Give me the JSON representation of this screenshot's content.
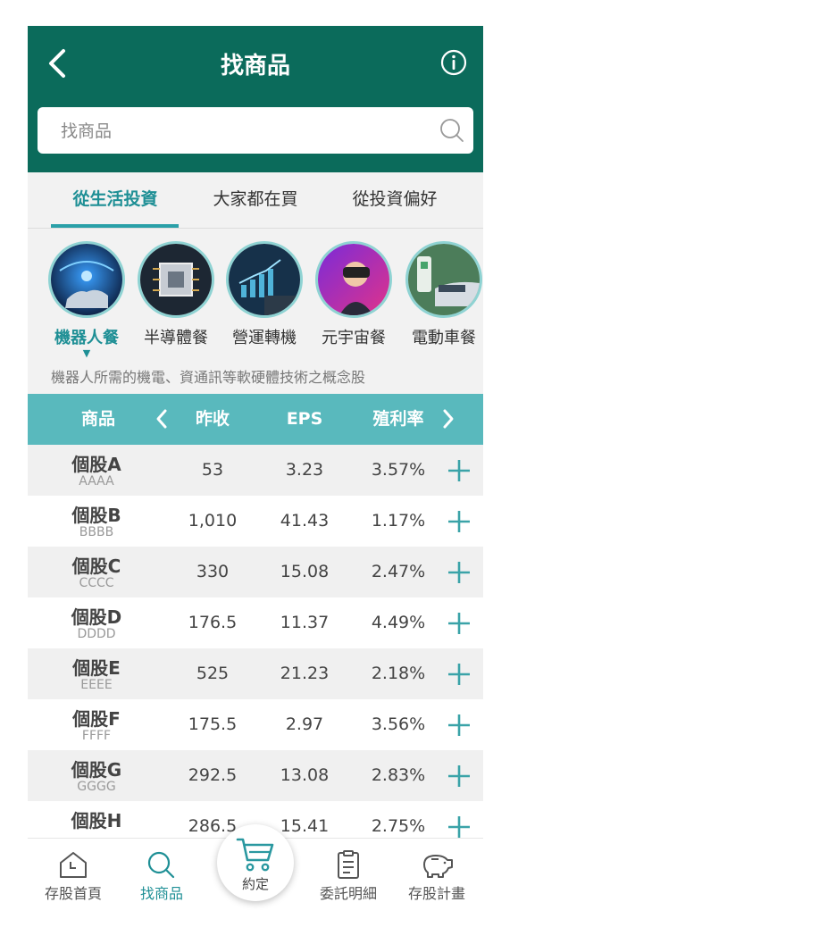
{
  "header": {
    "title": "找商品"
  },
  "search": {
    "placeholder": "找商品"
  },
  "tabs": [
    {
      "label": "從生活投資",
      "active": true
    },
    {
      "label": "大家都在買",
      "active": false
    },
    {
      "label": "從投資偏好",
      "active": false
    }
  ],
  "categories": [
    {
      "label": "機器人餐",
      "active": true
    },
    {
      "label": "半導體餐",
      "active": false
    },
    {
      "label": "營運轉機",
      "active": false
    },
    {
      "label": "元宇宙餐",
      "active": false
    },
    {
      "label": "電動車餐",
      "active": false
    }
  ],
  "category_marker": "▼",
  "category_description": "機器人所需的機電、資通訊等軟硬體技術之概念股",
  "table": {
    "headers": {
      "product": "商品",
      "close": "昨收",
      "eps": "EPS",
      "yield": "殖利率"
    },
    "rows": [
      {
        "name": "個股A",
        "code": "AAAA",
        "close": "53",
        "eps": "3.23",
        "yield": "3.57%"
      },
      {
        "name": "個股B",
        "code": "BBBB",
        "close": "1,010",
        "eps": "41.43",
        "yield": "1.17%"
      },
      {
        "name": "個股C",
        "code": "CCCC",
        "close": "330",
        "eps": "15.08",
        "yield": "2.47%"
      },
      {
        "name": "個股D",
        "code": "DDDD",
        "close": "176.5",
        "eps": "11.37",
        "yield": "4.49%"
      },
      {
        "name": "個股E",
        "code": "EEEE",
        "close": "525",
        "eps": "21.23",
        "yield": "2.18%"
      },
      {
        "name": "個股F",
        "code": "FFFF",
        "close": "175.5",
        "eps": "2.97",
        "yield": "3.56%"
      },
      {
        "name": "個股G",
        "code": "GGGG",
        "close": "292.5",
        "eps": "13.08",
        "yield": "2.83%"
      },
      {
        "name": "個股H",
        "code": "",
        "close": "286.5",
        "eps": "15.41",
        "yield": "2.75%"
      }
    ]
  },
  "bottom_nav": {
    "items": [
      {
        "label": "存股首頁",
        "icon": "home-icon",
        "active": false
      },
      {
        "label": "找商品",
        "icon": "search-icon",
        "active": true
      },
      {
        "label": "約定",
        "icon": "cart-icon",
        "active": false
      },
      {
        "label": "委託明細",
        "icon": "clipboard-icon",
        "active": false
      },
      {
        "label": "存股計畫",
        "icon": "piggy-bank-icon",
        "active": false
      }
    ]
  },
  "colors": {
    "header_bg": "#0b6b5b",
    "accent": "#1e8f95",
    "table_header_bg": "#59b9bd"
  }
}
